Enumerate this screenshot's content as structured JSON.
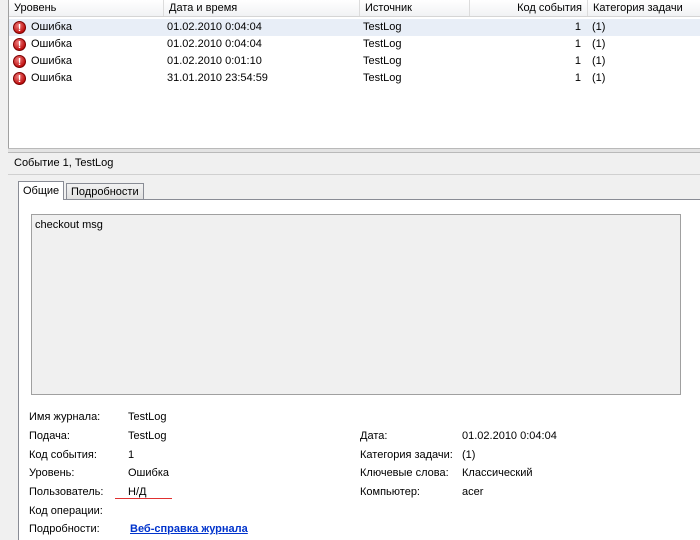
{
  "columns": {
    "level": "Уровень",
    "datetime": "Дата и время",
    "source": "Источник",
    "event_code": "Код события",
    "task_category": "Категория задачи"
  },
  "events": [
    {
      "level": "Ошибка",
      "datetime": "01.02.2010 0:04:04",
      "source": "TestLog",
      "event_code": "1",
      "task_category": "(1)"
    },
    {
      "level": "Ошибка",
      "datetime": "01.02.2010 0:04:04",
      "source": "TestLog",
      "event_code": "1",
      "task_category": "(1)"
    },
    {
      "level": "Ошибка",
      "datetime": "01.02.2010 0:01:10",
      "source": "TestLog",
      "event_code": "1",
      "task_category": "(1)"
    },
    {
      "level": "Ошибка",
      "datetime": "31.01.2010 23:54:59",
      "source": "TestLog",
      "event_code": "1",
      "task_category": "(1)"
    }
  ],
  "detail": {
    "title": "Событие 1, TestLog",
    "tabs": {
      "general": "Общие",
      "details": "Подробности"
    },
    "description": "checkout msg",
    "fields": {
      "log_name_label": "Имя журнала:",
      "log_name_value": "TestLog",
      "source_label": "Подача:",
      "source_value": "TestLog",
      "event_code_label": "Код события:",
      "event_code_value": "1",
      "level_label": "Уровень:",
      "level_value": "Ошибка",
      "user_label": "Пользователь:",
      "user_value": "Н/Д",
      "opcode_label": "Код операции:",
      "more_info_label": "Подробности:",
      "more_info_link": "Веб-справка журнала",
      "date_label": "Дата:",
      "date_value": "01.02.2010 0:04:04",
      "task_category_label": "Категория задачи:",
      "task_category_value": "(1)",
      "keywords_label": "Ключевые слова:",
      "keywords_value": "Классический",
      "computer_label": "Компьютер:",
      "computer_value": "acer"
    }
  },
  "icons": {
    "error": "error-icon"
  },
  "colors": {
    "selected_row": "#e8eef7",
    "link": "#0033cc",
    "error": "#c01010"
  }
}
